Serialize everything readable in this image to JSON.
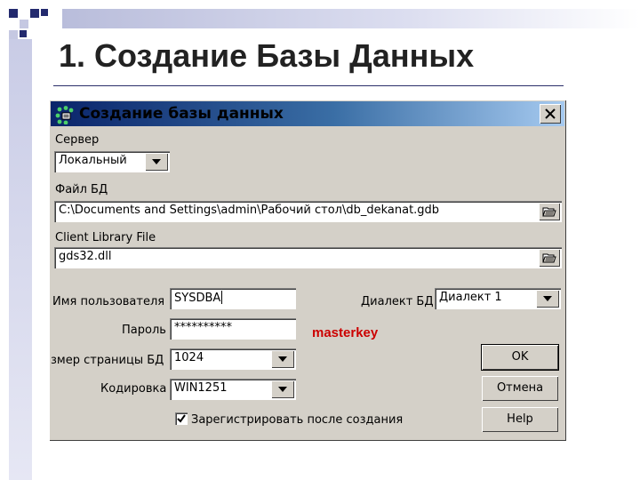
{
  "slide": {
    "title": "1. Создание Базы Данных"
  },
  "dialog": {
    "title": "Создание базы данных",
    "server_label": "Сервер",
    "server_value": "Локальный",
    "db_file_label": "Файл БД",
    "db_file_value": "C:\\Documents and Settings\\admin\\Рабочий стол\\db_dekanat.gdb",
    "client_lib_label": "Client Library File",
    "client_lib_value": "gds32.dll",
    "username_label": "Имя пользователя",
    "username_value": "SYSDBA",
    "password_label": "Пароль",
    "password_value": "**********",
    "password_hint": "masterkey",
    "page_size_label": "змер страницы БД",
    "page_size_value": "1024",
    "charset_label": "Кодировка",
    "charset_value": "WIN1251",
    "dialect_label": "Диалект БД",
    "dialect_value": "Диалект 1",
    "register_label": "Зарегистрировать после создания",
    "register_checked": true,
    "ok_label": "OK",
    "cancel_label": "Отмена",
    "help_label": "Help"
  },
  "colors": {
    "accent_dark": "#232a6e",
    "hint_red": "#cc0000",
    "dialog_face": "#d4d0c8"
  }
}
